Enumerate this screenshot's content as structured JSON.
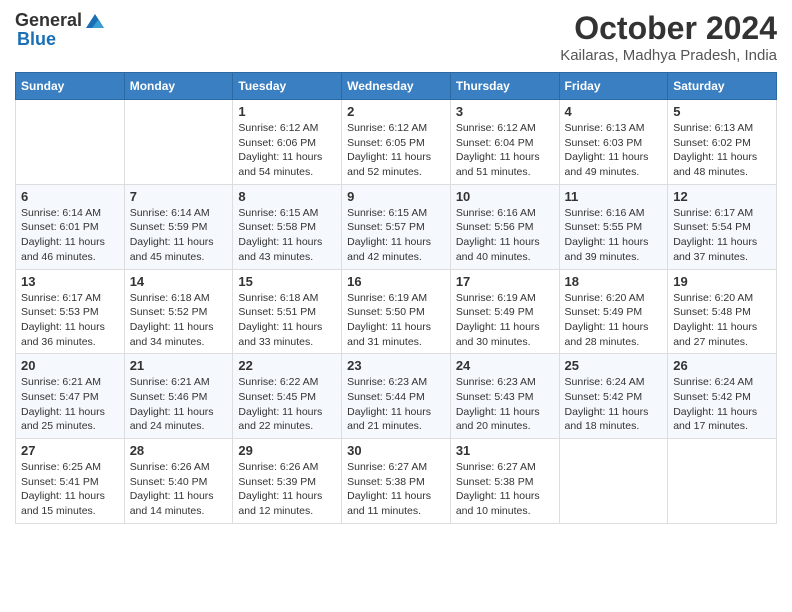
{
  "logo": {
    "general": "General",
    "blue": "Blue"
  },
  "header": {
    "title": "October 2024",
    "subtitle": "Kailaras, Madhya Pradesh, India"
  },
  "columns": [
    "Sunday",
    "Monday",
    "Tuesday",
    "Wednesday",
    "Thursday",
    "Friday",
    "Saturday"
  ],
  "weeks": [
    [
      {
        "day": "",
        "info": ""
      },
      {
        "day": "",
        "info": ""
      },
      {
        "day": "1",
        "info": "Sunrise: 6:12 AM\nSunset: 6:06 PM\nDaylight: 11 hours and 54 minutes."
      },
      {
        "day": "2",
        "info": "Sunrise: 6:12 AM\nSunset: 6:05 PM\nDaylight: 11 hours and 52 minutes."
      },
      {
        "day": "3",
        "info": "Sunrise: 6:12 AM\nSunset: 6:04 PM\nDaylight: 11 hours and 51 minutes."
      },
      {
        "day": "4",
        "info": "Sunrise: 6:13 AM\nSunset: 6:03 PM\nDaylight: 11 hours and 49 minutes."
      },
      {
        "day": "5",
        "info": "Sunrise: 6:13 AM\nSunset: 6:02 PM\nDaylight: 11 hours and 48 minutes."
      }
    ],
    [
      {
        "day": "6",
        "info": "Sunrise: 6:14 AM\nSunset: 6:01 PM\nDaylight: 11 hours and 46 minutes."
      },
      {
        "day": "7",
        "info": "Sunrise: 6:14 AM\nSunset: 5:59 PM\nDaylight: 11 hours and 45 minutes."
      },
      {
        "day": "8",
        "info": "Sunrise: 6:15 AM\nSunset: 5:58 PM\nDaylight: 11 hours and 43 minutes."
      },
      {
        "day": "9",
        "info": "Sunrise: 6:15 AM\nSunset: 5:57 PM\nDaylight: 11 hours and 42 minutes."
      },
      {
        "day": "10",
        "info": "Sunrise: 6:16 AM\nSunset: 5:56 PM\nDaylight: 11 hours and 40 minutes."
      },
      {
        "day": "11",
        "info": "Sunrise: 6:16 AM\nSunset: 5:55 PM\nDaylight: 11 hours and 39 minutes."
      },
      {
        "day": "12",
        "info": "Sunrise: 6:17 AM\nSunset: 5:54 PM\nDaylight: 11 hours and 37 minutes."
      }
    ],
    [
      {
        "day": "13",
        "info": "Sunrise: 6:17 AM\nSunset: 5:53 PM\nDaylight: 11 hours and 36 minutes."
      },
      {
        "day": "14",
        "info": "Sunrise: 6:18 AM\nSunset: 5:52 PM\nDaylight: 11 hours and 34 minutes."
      },
      {
        "day": "15",
        "info": "Sunrise: 6:18 AM\nSunset: 5:51 PM\nDaylight: 11 hours and 33 minutes."
      },
      {
        "day": "16",
        "info": "Sunrise: 6:19 AM\nSunset: 5:50 PM\nDaylight: 11 hours and 31 minutes."
      },
      {
        "day": "17",
        "info": "Sunrise: 6:19 AM\nSunset: 5:49 PM\nDaylight: 11 hours and 30 minutes."
      },
      {
        "day": "18",
        "info": "Sunrise: 6:20 AM\nSunset: 5:49 PM\nDaylight: 11 hours and 28 minutes."
      },
      {
        "day": "19",
        "info": "Sunrise: 6:20 AM\nSunset: 5:48 PM\nDaylight: 11 hours and 27 minutes."
      }
    ],
    [
      {
        "day": "20",
        "info": "Sunrise: 6:21 AM\nSunset: 5:47 PM\nDaylight: 11 hours and 25 minutes."
      },
      {
        "day": "21",
        "info": "Sunrise: 6:21 AM\nSunset: 5:46 PM\nDaylight: 11 hours and 24 minutes."
      },
      {
        "day": "22",
        "info": "Sunrise: 6:22 AM\nSunset: 5:45 PM\nDaylight: 11 hours and 22 minutes."
      },
      {
        "day": "23",
        "info": "Sunrise: 6:23 AM\nSunset: 5:44 PM\nDaylight: 11 hours and 21 minutes."
      },
      {
        "day": "24",
        "info": "Sunrise: 6:23 AM\nSunset: 5:43 PM\nDaylight: 11 hours and 20 minutes."
      },
      {
        "day": "25",
        "info": "Sunrise: 6:24 AM\nSunset: 5:42 PM\nDaylight: 11 hours and 18 minutes."
      },
      {
        "day": "26",
        "info": "Sunrise: 6:24 AM\nSunset: 5:42 PM\nDaylight: 11 hours and 17 minutes."
      }
    ],
    [
      {
        "day": "27",
        "info": "Sunrise: 6:25 AM\nSunset: 5:41 PM\nDaylight: 11 hours and 15 minutes."
      },
      {
        "day": "28",
        "info": "Sunrise: 6:26 AM\nSunset: 5:40 PM\nDaylight: 11 hours and 14 minutes."
      },
      {
        "day": "29",
        "info": "Sunrise: 6:26 AM\nSunset: 5:39 PM\nDaylight: 11 hours and 12 minutes."
      },
      {
        "day": "30",
        "info": "Sunrise: 6:27 AM\nSunset: 5:38 PM\nDaylight: 11 hours and 11 minutes."
      },
      {
        "day": "31",
        "info": "Sunrise: 6:27 AM\nSunset: 5:38 PM\nDaylight: 11 hours and 10 minutes."
      },
      {
        "day": "",
        "info": ""
      },
      {
        "day": "",
        "info": ""
      }
    ]
  ]
}
